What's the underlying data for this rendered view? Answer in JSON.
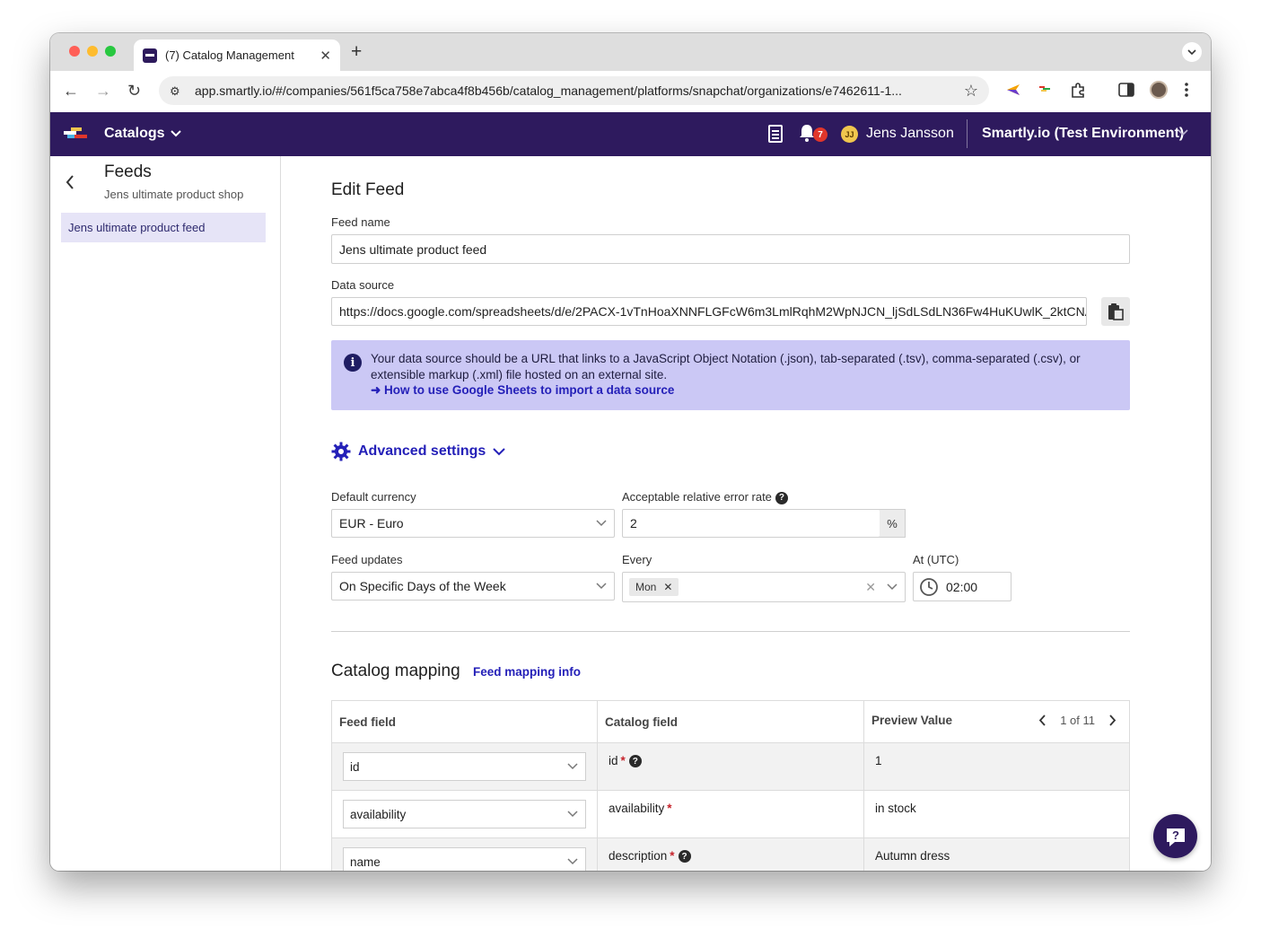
{
  "browser": {
    "tab_title": "(7) Catalog Management",
    "url": "app.smartly.io/#/companies/561f5ca758e7abca4f8b456b/catalog_management/platforms/snapchat/organizations/e7462611-1..."
  },
  "header": {
    "app_menu_label": "Catalogs",
    "notification_count": "7",
    "user_initials": "JJ",
    "user_name": "Jens Jansson",
    "organization": "Smartly.io (Test Environment)"
  },
  "sidebar": {
    "title": "Feeds",
    "subtitle": "Jens ultimate product shop",
    "items": [
      {
        "label": "Jens ultimate product feed"
      }
    ]
  },
  "form": {
    "title": "Edit Feed",
    "feed_name_label": "Feed name",
    "feed_name_value": "Jens ultimate product feed",
    "data_source_label": "Data source",
    "data_source_value": "https://docs.google.com/spreadsheets/d/e/2PACX-1vTnHoaXNNFLGFcW6m3LmlRqhM2WpNJCN_ljSdLSdLN36Fw4HuKUwlK_2ktCNAJ:",
    "info_text": "Your data source should be a URL that links to a JavaScript Object Notation (.json), tab-separated (.tsv), comma-separated (.csv), or extensible markup (.xml) file hosted on an external site.",
    "info_link": "➜ How to use Google Sheets to import a data source",
    "advanced_settings_label": "Advanced settings",
    "currency_label": "Default currency",
    "currency_value": "EUR - Euro",
    "error_rate_label": "Acceptable relative error rate",
    "error_rate_value": "2",
    "error_rate_unit": "%",
    "feed_updates_label": "Feed updates",
    "feed_updates_value": "On Specific Days of the Week",
    "every_label": "Every",
    "every_chip": "Mon",
    "at_label": "At (UTC)",
    "at_value": "02:00"
  },
  "mapping": {
    "title": "Catalog mapping",
    "info_link": "Feed mapping info",
    "columns": [
      "Feed field",
      "Catalog field",
      "Preview Value"
    ],
    "pager": "1 of 11",
    "rows": [
      {
        "feed_field": "id",
        "catalog_field": "id",
        "preview": "1"
      },
      {
        "feed_field": "availability",
        "catalog_field": "availability",
        "preview": "in stock"
      },
      {
        "feed_field": "name",
        "catalog_field": "description",
        "preview": "Autumn dress"
      }
    ]
  },
  "colors": {
    "brand": "#2e1a5e",
    "link": "#2420b8",
    "info_bg": "#cbc8f5",
    "required": "#c6232b"
  }
}
